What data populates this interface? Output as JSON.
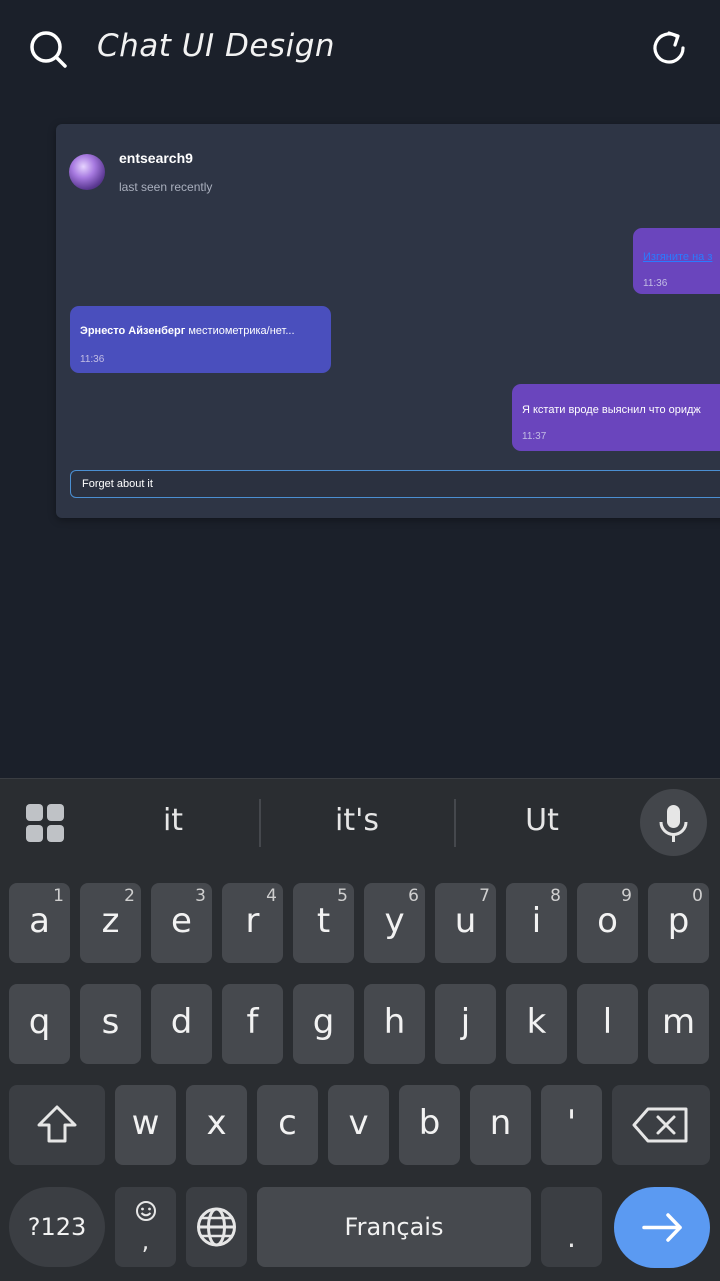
{
  "header": {
    "title": "Chat UI Design"
  },
  "chat": {
    "contact_name": "entsearch9",
    "contact_status": "last seen recently",
    "messages": [
      {
        "text": "Изгяните на з",
        "time": "11:36"
      },
      {
        "sender": "Эрнесто Айзенберг",
        "text": " местиометрика/нет...",
        "time": "11:36"
      },
      {
        "text": "Я кстати вроде выяснил что оридж",
        "time": "11:37"
      }
    ],
    "input_value": "Forget about it"
  },
  "keyboard": {
    "suggestions": [
      "it",
      "it's",
      "Ut"
    ],
    "row1": [
      {
        "ch": "a",
        "num": "1"
      },
      {
        "ch": "z",
        "num": "2"
      },
      {
        "ch": "e",
        "num": "3"
      },
      {
        "ch": "r",
        "num": "4"
      },
      {
        "ch": "t",
        "num": "5"
      },
      {
        "ch": "y",
        "num": "6"
      },
      {
        "ch": "u",
        "num": "7"
      },
      {
        "ch": "i",
        "num": "8"
      },
      {
        "ch": "o",
        "num": "9"
      },
      {
        "ch": "p",
        "num": "0"
      }
    ],
    "row2": [
      "q",
      "s",
      "d",
      "f",
      "g",
      "h",
      "j",
      "k",
      "l",
      "m"
    ],
    "row3": [
      "w",
      "x",
      "c",
      "v",
      "b",
      "n",
      "'"
    ],
    "symbols_label": "?123",
    "emoji_comma": ",",
    "space_label": "Français",
    "period": "."
  }
}
